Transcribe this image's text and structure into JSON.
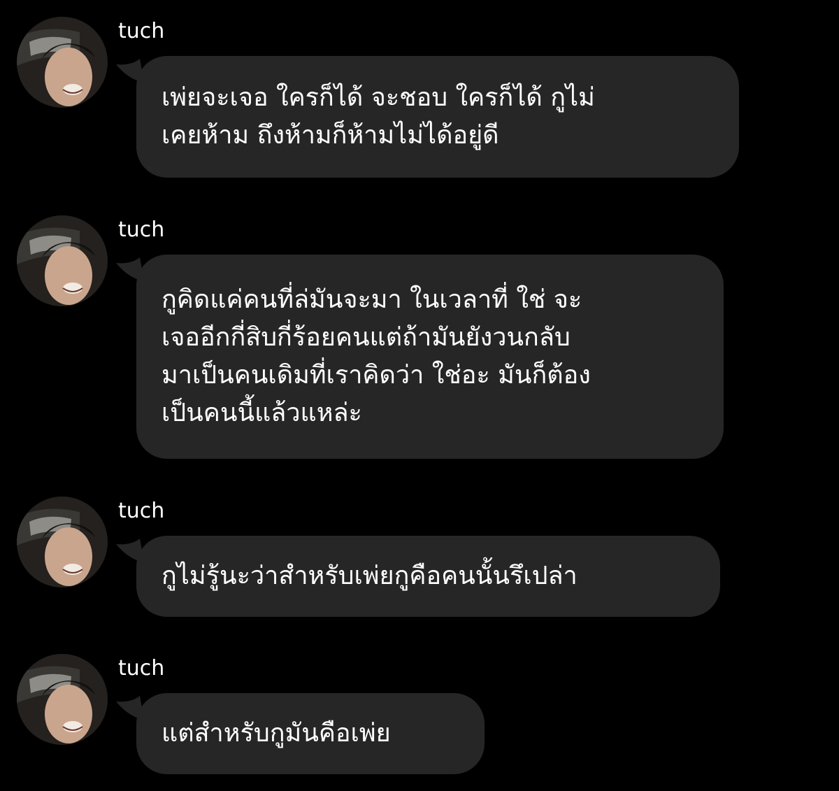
{
  "messages": [
    {
      "sender": "tuch",
      "text": "เพ่ยจะเจอ ใครก็ได้ จะชอบ ใครก็ได้ กูไม่\nเคยห้าม ถึงห้ามก็ห้ามไม่ได้อยู่ดี"
    },
    {
      "sender": "tuch",
      "text": "กูคิดแค่คนที่ล่มันจะมา ในเวลาที่ ใช่ จะ\nเจออีกกี่สิบกี่ร้อยคนแต่ถ้ามันยังวนกลับ\nมาเป็นคนเดิมที่เราคิดว่า ใช่อะ มันก็ต้อง\nเป็นคนนี้แล้วแหล่ะ"
    },
    {
      "sender": "tuch",
      "text": "กูไม่รู้นะว่าสำหรับเพ่ยกูคือคนนั้นรึเปล่า"
    },
    {
      "sender": "tuch",
      "text": "แต่สำหรับกูมันคือเพ่ย"
    }
  ],
  "colors": {
    "background": "#000000",
    "bubble": "#262626",
    "text": "#ffffff"
  }
}
